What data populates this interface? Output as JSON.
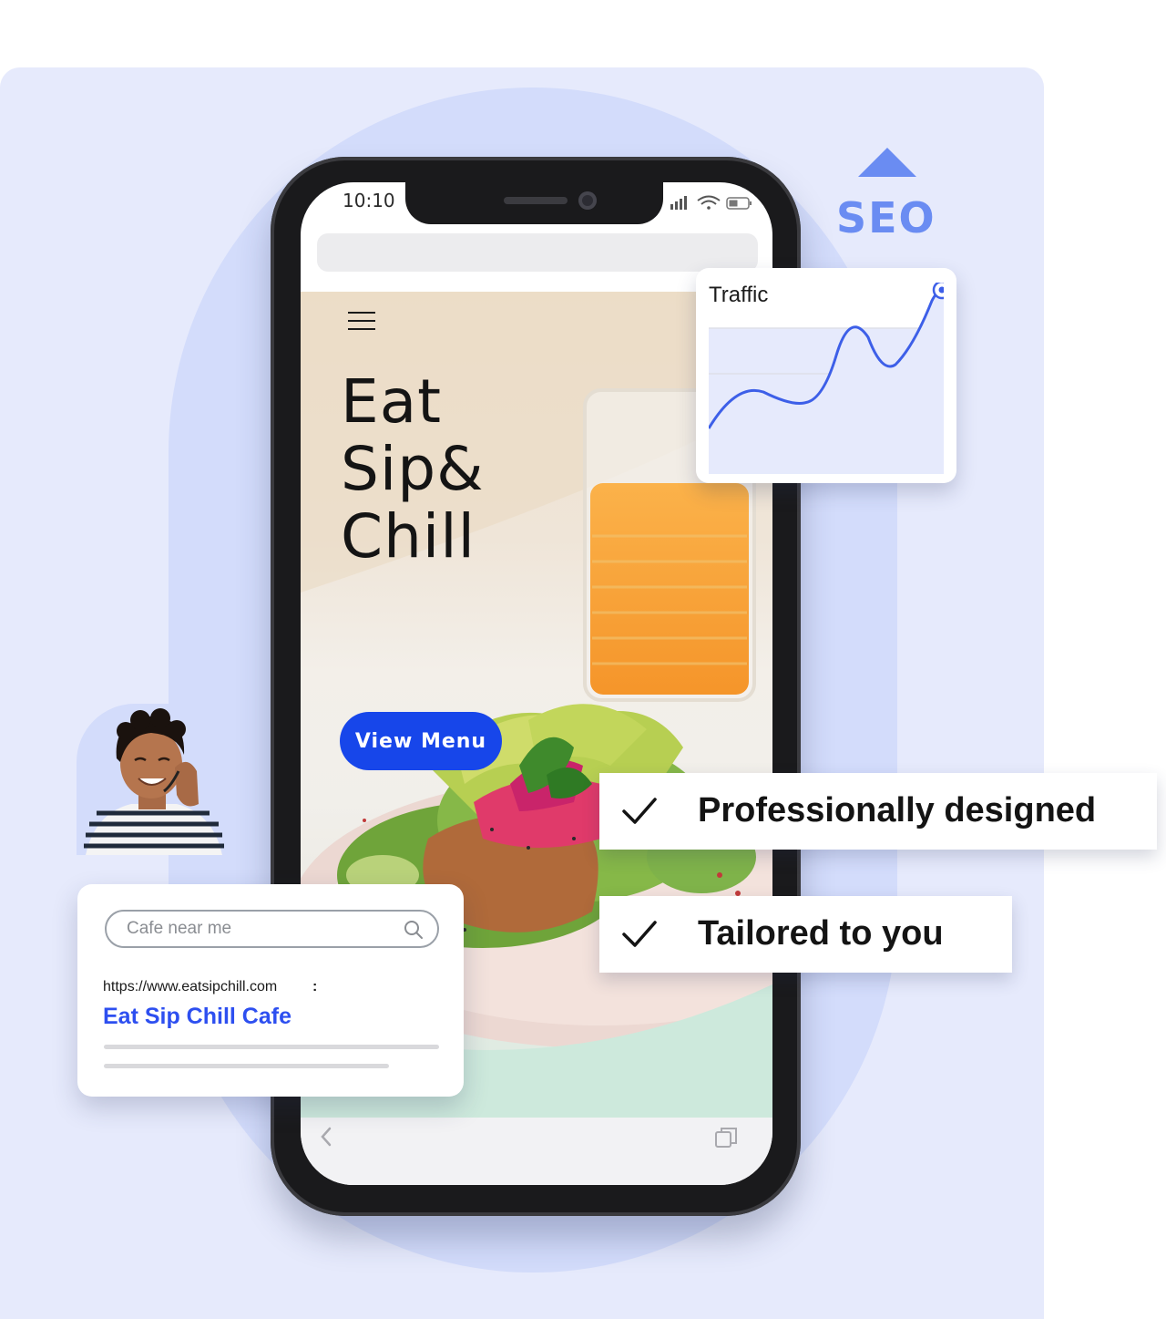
{
  "phone": {
    "status_time": "10:10",
    "hero": {
      "title_lines": [
        "Eat",
        "Sip&",
        "Chill"
      ],
      "cta_label": "View Menu"
    }
  },
  "seo": {
    "label": "SEO"
  },
  "traffic_card": {
    "title": "Traffic"
  },
  "search_card": {
    "placeholder": "Cafe near me",
    "result_url": "https://www.eatsipchill.com",
    "result_menu": ":",
    "result_title": "Eat Sip Chill Cafe"
  },
  "features": [
    {
      "label": "Professionally designed"
    },
    {
      "label": "Tailored to you"
    }
  ],
  "colors": {
    "panel_bg": "#e6eafc",
    "blob": "#d3dcfb",
    "brand_blue": "#1746ea",
    "seo_blue": "#6a8cf2",
    "link_blue": "#2d4ff0"
  },
  "icons": [
    "hamburger-menu-icon",
    "seo-arrow-up-icon",
    "search-icon",
    "check-icon",
    "back-chevron-icon",
    "tabs-icon",
    "signal-icon",
    "wifi-icon",
    "battery-icon"
  ]
}
